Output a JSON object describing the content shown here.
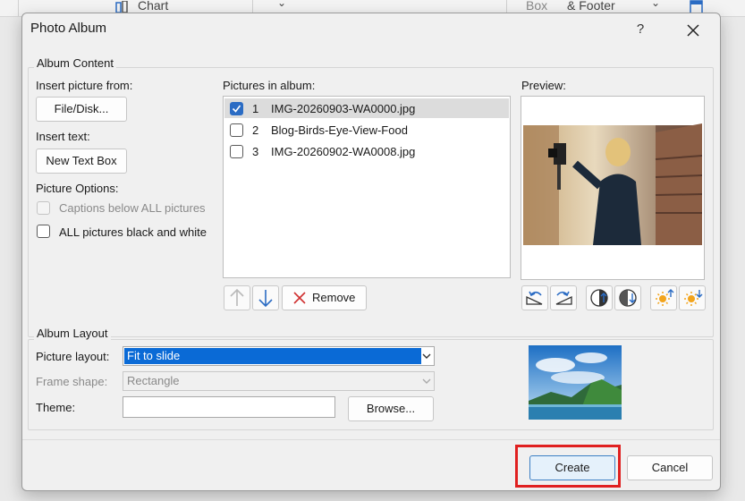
{
  "background": {
    "chart_label": "Chart",
    "box_label": "Box",
    "footer_label": "& Footer"
  },
  "dialog": {
    "title": "Photo Album",
    "help_label": "?",
    "close_icon": "close-icon"
  },
  "album_content": {
    "legend": "Album Content",
    "insert_picture_label": "Insert picture from:",
    "file_disk_button": "File/Disk...",
    "insert_text_label": "Insert text:",
    "new_text_box_button": "New Text Box",
    "picture_options_label": "Picture Options:",
    "captions_option": "Captions below ALL pictures",
    "captions_checked": false,
    "captions_enabled": false,
    "black_white_option": "ALL pictures black and white",
    "black_white_checked": false,
    "pictures_label": "Pictures in album:",
    "pictures": [
      {
        "num": "1",
        "name": "IMG-20260903-WA0000.jpg",
        "checked": true,
        "selected": true
      },
      {
        "num": "2",
        "name": "Blog-Birds-Eye-View-Food",
        "checked": false,
        "selected": false
      },
      {
        "num": "3",
        "name": "IMG-20260902-WA0008.jpg",
        "checked": false,
        "selected": false
      }
    ],
    "move_up_icon": "arrow-up-icon",
    "move_down_icon": "arrow-down-icon",
    "remove_button": "Remove",
    "preview_label": "Preview:",
    "preview_tools": [
      "rotate-left-icon",
      "rotate-right-icon",
      "contrast-increase-icon",
      "contrast-decrease-icon",
      "brightness-increase-icon",
      "brightness-decrease-icon"
    ]
  },
  "album_layout": {
    "legend": "Album Layout",
    "picture_layout_label": "Picture layout:",
    "picture_layout_value": "Fit to slide",
    "frame_shape_label": "Frame shape:",
    "frame_shape_value": "Rectangle",
    "theme_label": "Theme:",
    "theme_value": "",
    "browse_button": "Browse..."
  },
  "footer": {
    "create_button": "Create",
    "cancel_button": "Cancel"
  },
  "colors": {
    "accent": "#2b6cc4",
    "highlight_box": "#e02020",
    "select_highlight": "#0a6ad6"
  }
}
